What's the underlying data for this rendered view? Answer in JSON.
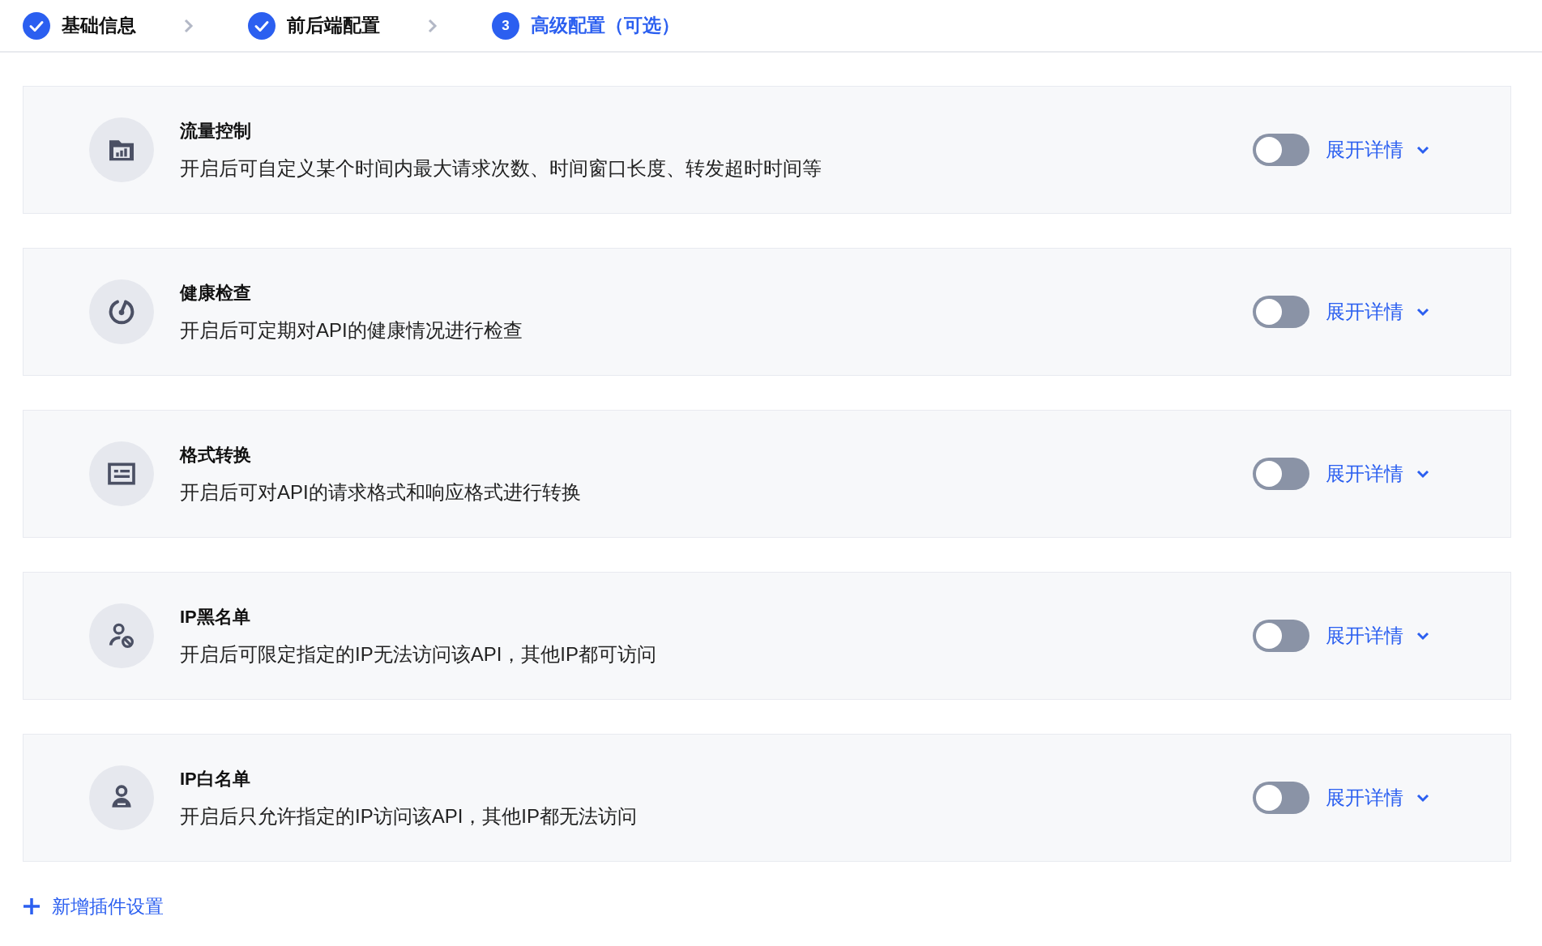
{
  "steps": [
    {
      "label": "基础信息",
      "completed": true,
      "selected": false
    },
    {
      "label": "前后端配置",
      "completed": true,
      "selected": false
    },
    {
      "label": "高级配置（可选）",
      "completed": false,
      "selected": true,
      "number": "3"
    }
  ],
  "plugins": [
    {
      "kind": "traffic",
      "title": "流量控制",
      "description": "开启后可自定义某个时间内最大请求次数、时间窗口长度、转发超时时间等",
      "on": false,
      "link": "展开详情"
    },
    {
      "kind": "health",
      "title": "健康检查",
      "description": "开启后可定期对API的健康情况进行检查",
      "on": false,
      "link": "展开详情"
    },
    {
      "kind": "format",
      "title": "格式转换",
      "description": "开启后可对API的请求格式和响应格式进行转换",
      "on": false,
      "link": "展开详情"
    },
    {
      "kind": "blacklist",
      "title": "IP黑名单",
      "description": "开启后可限定指定的IP无法访问该API，其他IP都可访问",
      "on": false,
      "link": "展开详情"
    },
    {
      "kind": "whitelist",
      "title": "IP白名单",
      "description": "开启后只允许指定的IP访问该API，其他IP都无法访问",
      "on": false,
      "link": "展开详情"
    }
  ],
  "add_button": {
    "label": "新增插件设置"
  }
}
